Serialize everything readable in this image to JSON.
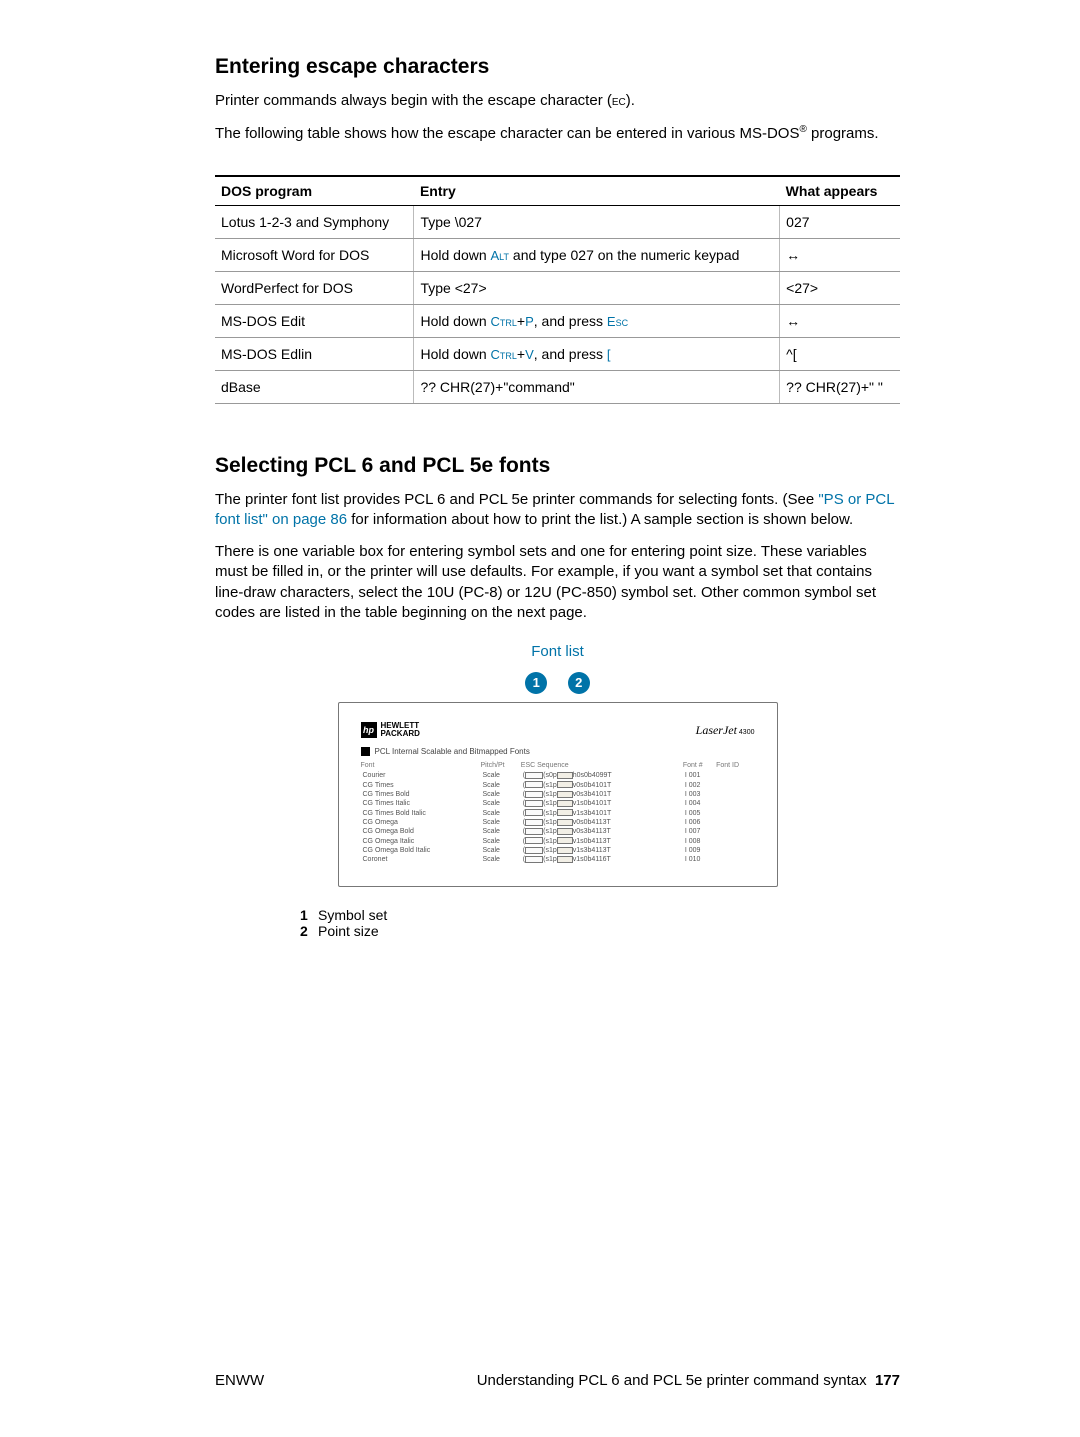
{
  "section1": {
    "heading": "Entering escape characters",
    "para1_pre": "Printer commands always begin with the escape character (",
    "para1_esc": "EC",
    "para1_post": ").",
    "para2_pre": "The following table shows how the escape character can be entered in various MS-DOS",
    "para2_reg": "®",
    "para2_post": " programs."
  },
  "dos_table": {
    "headers": {
      "c1": "DOS program",
      "c2": "Entry",
      "c3": "What appears"
    },
    "rows": [
      {
        "prog": "Lotus 1-2-3 and Symphony",
        "entry_plain": "Type \\027",
        "appears": "027"
      },
      {
        "prog": "Microsoft Word for DOS",
        "entry_pre": "Hold down ",
        "entry_key1": "Alt",
        "entry_mid": " and type 027 on the numeric keypad",
        "appears": "↔"
      },
      {
        "prog": "WordPerfect for DOS",
        "entry_plain": "Type <27>",
        "appears": "<27>"
      },
      {
        "prog": "MS-DOS Edit",
        "entry_pre": "Hold down ",
        "entry_key1": "Ctrl",
        "entry_plus": "+",
        "entry_key2": "P",
        "entry_mid2": ", and press ",
        "entry_key3": "Esc",
        "appears": "↔"
      },
      {
        "prog": "MS-DOS Edlin",
        "entry_pre": "Hold down ",
        "entry_key1": "Ctrl",
        "entry_plus": "+",
        "entry_key2": "V",
        "entry_mid2": ", and press ",
        "entry_key3": "[",
        "appears": "^["
      },
      {
        "prog": "dBase",
        "entry_plain": "?? CHR(27)+\"command\"",
        "appears": "?? CHR(27)+\"  \""
      }
    ]
  },
  "section2": {
    "heading": "Selecting PCL 6 and PCL 5e fonts",
    "para1_a": "The printer font list provides PCL 6 and PCL 5e printer commands for selecting fonts. (See ",
    "para1_link": "\"PS or PCL font list\" on page 86",
    "para1_b": " for information about how to print the list.) A sample section is shown below.",
    "para2": "There is one variable box for entering symbol sets and one for entering point size. These variables must be filled in, or the printer will use defaults. For example, if you want a symbol set that contains line-draw characters, select the 10U (PC-8) or 12U (PC-850) symbol set. Other common symbol set codes are listed in the table beginning on the next page.",
    "caption": "Font list"
  },
  "figure": {
    "callout1": "1",
    "callout2": "2",
    "hp_label1": "HEWLETT",
    "hp_label2": "PACKARD",
    "hp_icon": "hp",
    "laserjet": "LaserJet",
    "laserjet_model": " 4300",
    "inner_title": "PCL Internal Scalable and Bitmapped Fonts",
    "cols": {
      "font": "Font",
      "pitch": "Pitch/Pt",
      "esc": "ESC Sequence",
      "fontn": "Font #",
      "fontid": "Font ID"
    },
    "rows": [
      {
        "name": "Courier",
        "pitch": "Scale",
        "seq_a": "<esc>(",
        "seq_b": "<esc>(s0p",
        "seq_c": "h0s0b4099T",
        "num": "I 001"
      },
      {
        "name": "CG Times",
        "pitch": "Scale",
        "seq_a": "<esc>(",
        "seq_b": "<esc>(s1p",
        "seq_c": "v0s0b4101T",
        "num": "I 002"
      },
      {
        "name": "CG Times Bold",
        "pitch": "Scale",
        "seq_a": "<esc>(",
        "seq_b": "<esc>(s1p",
        "seq_c": "v0s3b4101T",
        "num": "I 003"
      },
      {
        "name": "CG Times Italic",
        "pitch": "Scale",
        "seq_a": "<esc>(",
        "seq_b": "<esc>(s1p",
        "seq_c": "v1s0b4101T",
        "num": "I 004"
      },
      {
        "name": "CG Times Bold Italic",
        "pitch": "Scale",
        "seq_a": "<esc>(",
        "seq_b": "<esc>(s1p",
        "seq_c": "v1s3b4101T",
        "num": "I 005"
      },
      {
        "name": "CG Omega",
        "pitch": "Scale",
        "seq_a": "<esc>(",
        "seq_b": "<esc>(s1p",
        "seq_c": "v0s0b4113T",
        "num": "I 006"
      },
      {
        "name": "CG Omega Bold",
        "pitch": "Scale",
        "seq_a": "<esc>(",
        "seq_b": "<esc>(s1p",
        "seq_c": "v0s3b4113T",
        "num": "I 007"
      },
      {
        "name": "CG Omega Italic",
        "pitch": "Scale",
        "seq_a": "<esc>(",
        "seq_b": "<esc>(s1p",
        "seq_c": "v1s0b4113T",
        "num": "I 008"
      },
      {
        "name": "CG Omega Bold Italic",
        "pitch": "Scale",
        "seq_a": "<esc>(",
        "seq_b": "<esc>(s1p",
        "seq_c": "v1s3b4113T",
        "num": "I 009"
      },
      {
        "name": "Coronet",
        "pitch": "Scale",
        "seq_a": "<esc>(",
        "seq_b": "<esc>(s1p",
        "seq_c": "v1s0b4116T",
        "num": "I 010"
      }
    ]
  },
  "legend": {
    "item1_num": "1",
    "item1_text": "Symbol set",
    "item2_num": "2",
    "item2_text": "Point size"
  },
  "footer": {
    "left": "ENWW",
    "right_text": "Understanding PCL 6 and PCL 5e printer command syntax",
    "right_page": "177"
  }
}
